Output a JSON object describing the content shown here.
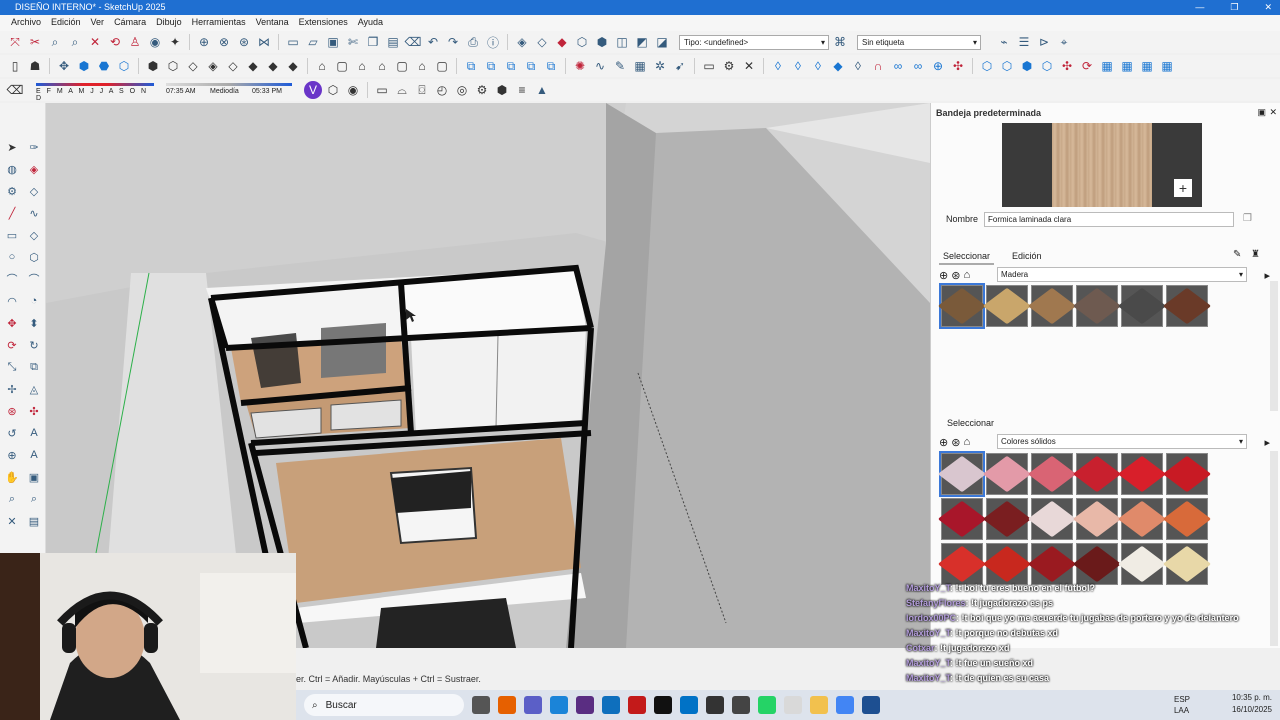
{
  "window": {
    "title": "DISEÑO INTERNO* - SketchUp 2025",
    "min": "—",
    "max": "❐",
    "close": "✕"
  },
  "menu": [
    "Archivo",
    "Edición",
    "Ver",
    "Cámara",
    "Dibujo",
    "Herramientas",
    "Ventana",
    "Extensiones",
    "Ayuda"
  ],
  "toolbar": {
    "tipo_combo": "Tipo: <undefined>",
    "etiqueta_combo": "Sin etiqueta",
    "months": "E F M A M J J A S O N D",
    "time_start": "07:35 AM",
    "time_mid": "Mediodía",
    "time_end": "05:33 PM"
  },
  "tray": {
    "title": "Bandeja predeterminada",
    "name_label": "Nombre",
    "name_value": "Formica laminada clara",
    "tab_select": "Seleccionar",
    "tab_edit": "Edición",
    "library1": "Madera",
    "section2_title": "Seleccionar",
    "library2": "Colores sólidos",
    "wood_swatches": [
      "#7a5a3a",
      "#c9a66b",
      "#a0784f",
      "#6e5a50",
      "#4a4a4a",
      "#6a3a28"
    ],
    "color_swatches": [
      "#d9c6cf",
      "#e39aa8",
      "#d96474",
      "#c8202e",
      "#d81f2a",
      "#c81a24",
      "#a8162a",
      "#7a1e20",
      "#e8d8d8",
      "#e8b8a8",
      "#e08a6a",
      "#d86a3a",
      "#d8302a",
      "#c8281e",
      "#9a1a20",
      "#6a1a1a",
      "#f0ece4",
      "#e8d8a8"
    ]
  },
  "status": {
    "hint": "er. Ctrl = Añadir. Mayúsculas + Ctrl = Sustraer."
  },
  "taskbar": {
    "search": "Buscar",
    "lang1": "ESP",
    "lang2": "LAA",
    "time": "10:35 p. m.",
    "date": "16/10/2025"
  },
  "chat": [
    {
      "user": "MaxitoY_T",
      "text": ": !t boi tu eres bueno en el futbol?"
    },
    {
      "user": "StefanyFlores",
      "text": ": !t jugadorazo es ps"
    },
    {
      "user": "lordox00PC",
      "text": ": !t boi que yo me acuerde tu jugabas de portero y yo de delantero"
    },
    {
      "user": "MaxitoY_T",
      "text": ": !t porque no debutas xd"
    },
    {
      "user": "Cotxar",
      "text": ": !t jugadorazo xd"
    },
    {
      "user": "MaxitoY_T",
      "text": ": !t fue un sueño xd"
    },
    {
      "user": "MaxitoY_T",
      "text": ": !t de quien es su casa"
    }
  ]
}
